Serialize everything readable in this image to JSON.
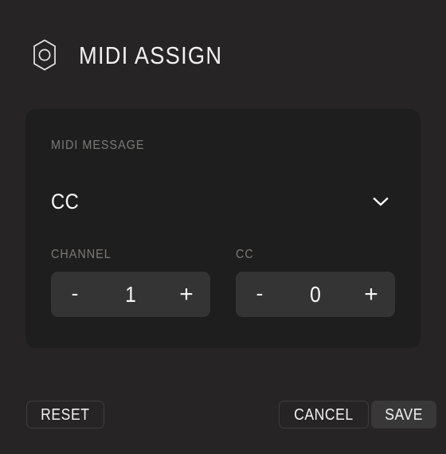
{
  "header": {
    "icon": "hexagon-nut-icon",
    "title": "MIDI ASSIGN"
  },
  "panel": {
    "midi_message": {
      "label": "MIDI MESSAGE",
      "value": "CC",
      "dropdown_icon": "chevron-down-icon"
    },
    "channel": {
      "label": "CHANNEL",
      "value": "1",
      "decrement_label": "-",
      "increment_label": "+"
    },
    "cc": {
      "label": "CC",
      "value": "0",
      "decrement_label": "-",
      "increment_label": "+"
    }
  },
  "footer": {
    "reset_label": "RESET",
    "cancel_label": "CANCEL",
    "save_label": "SAVE"
  },
  "colors": {
    "background": "#262424",
    "panel": "#1f1e1e",
    "stepper": "#343434",
    "save_button": "#393838",
    "text_primary": "#fbfbfb",
    "text_muted": "#7b7a78",
    "border": "#3f3e3e"
  }
}
